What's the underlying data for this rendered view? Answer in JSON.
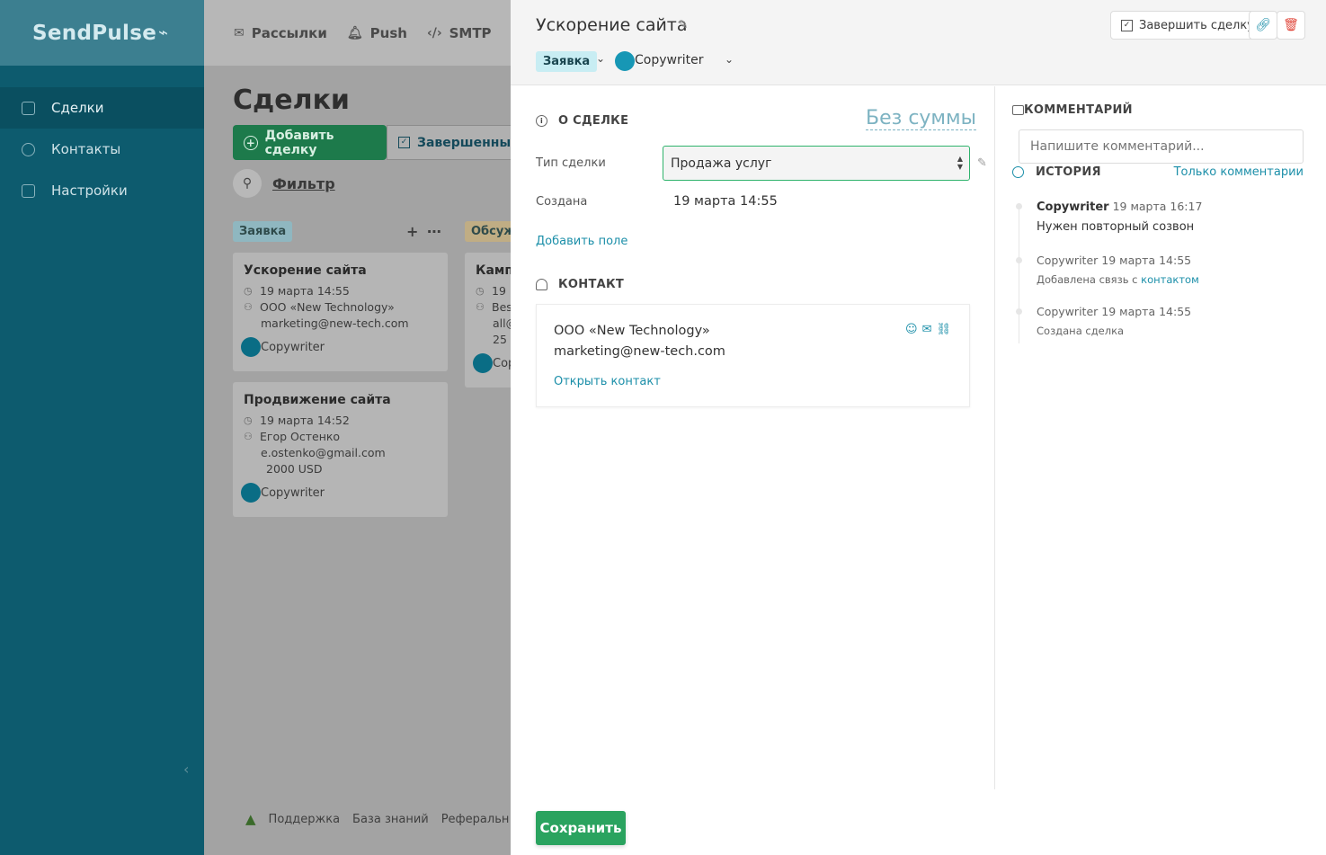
{
  "app": {
    "logo": "SendPulse"
  },
  "sidebar": {
    "items": [
      {
        "label": "Сделки",
        "icon": "list-icon"
      },
      {
        "label": "Контакты",
        "icon": "contacts-icon"
      },
      {
        "label": "Настройки",
        "icon": "settings-icon"
      }
    ]
  },
  "topnav": {
    "items": [
      {
        "label": "Рассылки",
        "icon": "mail-icon"
      },
      {
        "label": "Push",
        "icon": "bell-icon"
      },
      {
        "label": "SMTP",
        "icon": "code-icon"
      }
    ]
  },
  "main": {
    "title": "Сделки",
    "add_button": "Добавить сделку",
    "done_button": "Завершенные",
    "filter_label": "Фильтр",
    "columns": [
      {
        "label": "Заявка"
      },
      {
        "label": "Обсуж"
      }
    ],
    "cards": [
      {
        "title": "Ускорение сайта",
        "date": "19 марта 14:55",
        "company": "ООО «New Technology»",
        "email": "marketing@new-tech.com",
        "owner": "Copywriter"
      },
      {
        "title": "Продвижение сайта",
        "date": "19 марта 14:52",
        "company": "Егор Остенко",
        "email": "e.ostenko@gmail.com",
        "amount": "2000 USD",
        "owner": "Copywriter"
      },
      {
        "title": "Камп",
        "date": "19",
        "company": "Bes",
        "email": "all@",
        "extra": "25",
        "owner": "Cop"
      }
    ],
    "footer": {
      "support": "Поддержка",
      "kb": "База знаний",
      "ref": "Реферальн"
    }
  },
  "panel": {
    "title": "Ускорение сайта",
    "stage": "Заявка",
    "owner": "Copywriter",
    "finish_button": "Завершить сделку",
    "about_heading": "О СДЕЛКЕ",
    "no_sum": "Без суммы",
    "deal_type_label": "Тип сделки",
    "deal_type_value": "Продажа услуг",
    "created_label": "Создана",
    "created_value": "19 марта 14:55",
    "add_field": "Добавить поле",
    "contact_heading": "КОНТАКТ",
    "contact": {
      "name": "ООО «New Technology»",
      "email": "marketing@new-tech.com",
      "open_link": "Открыть контакт"
    },
    "comments_heading": "КОММЕНТАРИЙ",
    "comment_placeholder": "Напишите комментарий...",
    "history_heading": "ИСТОРИЯ",
    "only_comments": "Только комментарии",
    "history": [
      {
        "author": "Copywriter",
        "time": "19 марта 16:17",
        "text": "Нужен повторный созвон"
      },
      {
        "author": "Copywriter",
        "time": "19 марта 14:55",
        "text_prefix": "Добавлена связь с",
        "text_link": "контактом"
      },
      {
        "author": "Copywriter",
        "time": "19 марта 14:55",
        "text": "Создана сделка"
      }
    ],
    "save_button": "Сохранить"
  },
  "colors": {
    "sidebar_bg": "#0d5b6e",
    "accent_green": "#2aa35f",
    "link_blue": "#1c8fa9",
    "stage_pill": "#c8edf3",
    "danger": "#e0473b"
  }
}
